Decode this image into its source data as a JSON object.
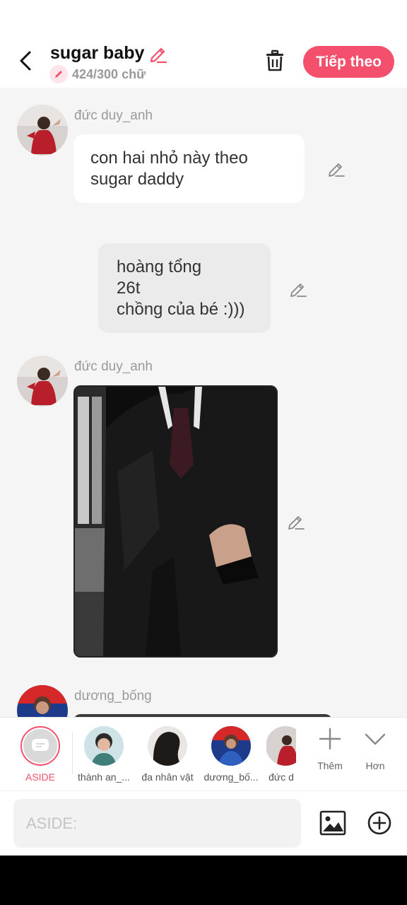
{
  "header": {
    "title": "sugar baby",
    "word_count": "424/300 chữ",
    "next_label": "Tiếp theo",
    "icons": [
      "back-arrow-icon",
      "pencil-icon",
      "pen-badge-icon",
      "trash-icon"
    ],
    "accent": "#f4506d"
  },
  "messages": [
    {
      "speaker": "đức duy_anh",
      "lines": [
        "con hai nhỏ này theo",
        "sugar daddy"
      ],
      "type": "text"
    },
    {
      "speaker": "",
      "lines": [
        "hoàng tổng",
        "26t",
        "chồng của bé :)))"
      ],
      "type": "narration"
    },
    {
      "speaker": "đức duy_anh",
      "type": "image",
      "alt": "man in dark suit photo"
    },
    {
      "speaker": "dương_bống",
      "type": "partial"
    }
  ],
  "characters": {
    "aside_label": "ASIDE",
    "items": [
      {
        "name": "thành an_..."
      },
      {
        "name": "đa nhân vật"
      },
      {
        "name": "dương_bố..."
      },
      {
        "name": "đức d"
      }
    ],
    "more_label": "Thêm",
    "expand_label": "Hơn"
  },
  "composer": {
    "placeholder": "ASIDE:",
    "icons": [
      "image-icon",
      "add-circle-icon"
    ]
  }
}
